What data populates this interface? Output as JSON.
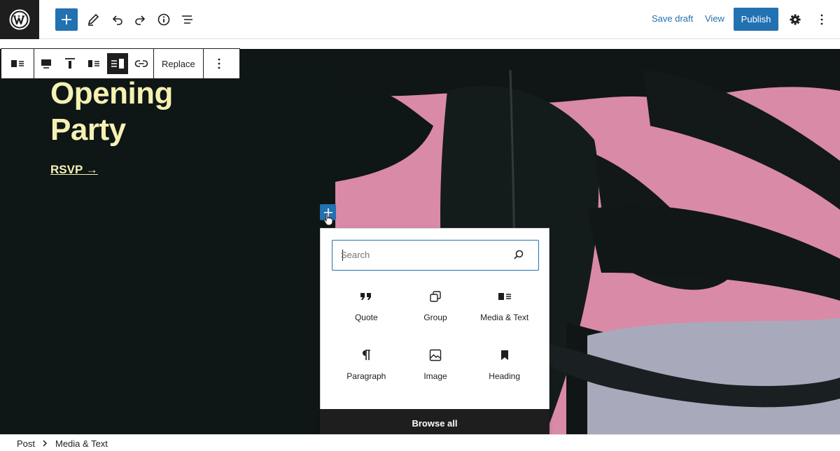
{
  "header": {
    "save_draft": "Save draft",
    "view": "View",
    "publish": "Publish"
  },
  "icons": {
    "logo": "wordpress-icon",
    "add": "plus-icon",
    "tools": "pencil-icon",
    "undo": "undo-icon",
    "redo": "redo-icon",
    "details": "info-icon",
    "list_view": "list-view-icon",
    "settings": "gear-icon",
    "options": "more-vertical-icon"
  },
  "canvas": {
    "heading_line1": "Opening",
    "heading_line2": "Party",
    "rsvp": "RSVP →"
  },
  "block_toolbar": {
    "replace": "Replace"
  },
  "inserter": {
    "search_placeholder": "Search",
    "blocks": [
      {
        "label": "Quote",
        "icon": "quote-icon"
      },
      {
        "label": "Group",
        "icon": "group-icon"
      },
      {
        "label": "Media & Text",
        "icon": "media-text-icon"
      },
      {
        "label": "Paragraph",
        "icon": "paragraph-icon"
      },
      {
        "label": "Image",
        "icon": "image-icon"
      },
      {
        "label": "Heading",
        "icon": "bookmark-icon"
      }
    ],
    "browse_all": "Browse all"
  },
  "breadcrumb": {
    "root": "Post",
    "current": "Media & Text"
  },
  "colors": {
    "accent": "#2271b1",
    "dark_panel": "#0e1616",
    "heading": "#f6f1b2",
    "media_pink": "#d98aa7"
  }
}
